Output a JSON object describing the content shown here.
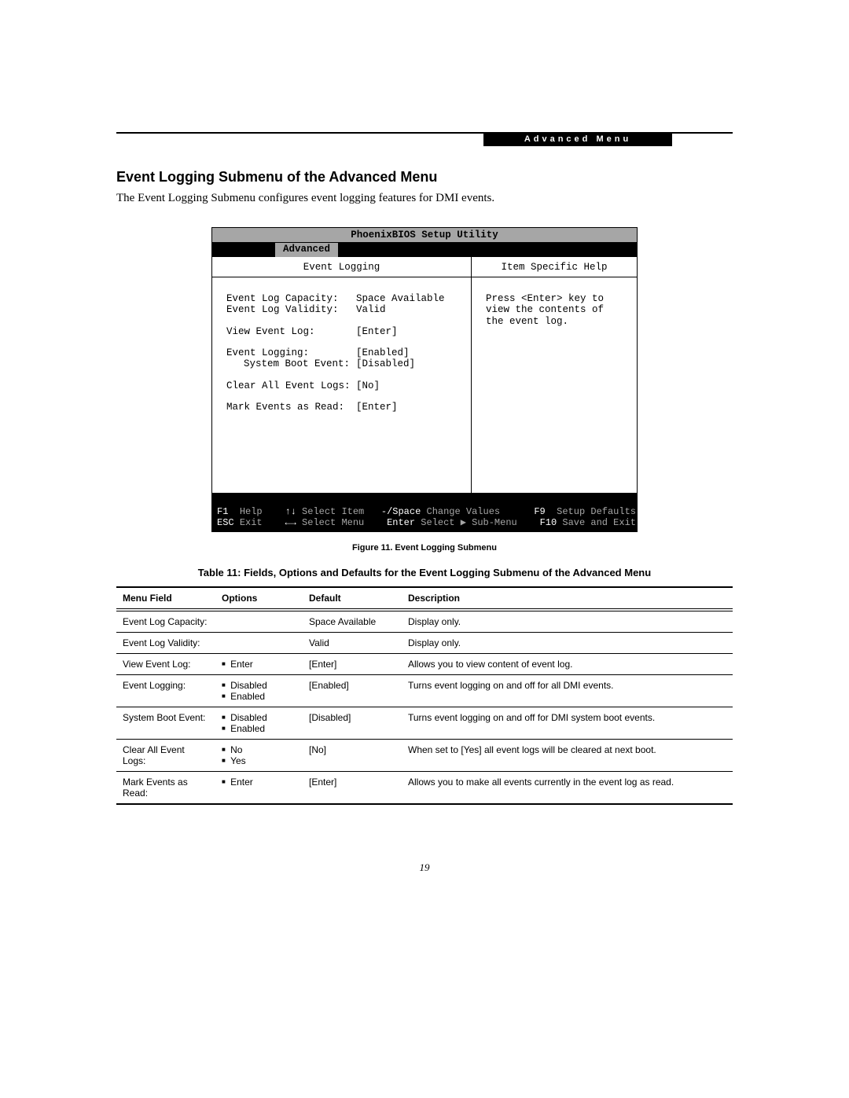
{
  "header_tag": "Advanced Menu",
  "section_title": "Event Logging Submenu of the Advanced Menu",
  "intro": "The Event Logging Submenu configures event logging features for DMI events.",
  "bios": {
    "title": "PhoenixBIOS Setup Utility",
    "tab": "Advanced",
    "left_title": "Event Logging",
    "right_title": "Item Specific Help",
    "help_text_1": "Press <Enter> key to",
    "help_text_2": "view the contents of",
    "help_text_3": "the event log.",
    "fields": {
      "capacity_label": "Event Log Capacity:",
      "capacity_value": "Space Available",
      "validity_label": "Event Log Validity:",
      "validity_value": "Valid",
      "view_label": "View Event Log:",
      "view_value": "[Enter]",
      "logging_label": "Event Logging:",
      "logging_value": "[Enabled]",
      "boot_label": "System Boot Event:",
      "boot_value": "[Disabled]",
      "clear_label": "Clear All Event Logs:",
      "clear_value": "[No]",
      "mark_label": "Mark Events as Read:",
      "mark_value": "[Enter]"
    },
    "footer": {
      "k_f1": "F1",
      "l_help": "Help",
      "k_arrows_v": "↑↓",
      "l_select_item": "Select Item",
      "k_space": "-/Space",
      "l_change": "Change Values",
      "k_f9": "F9",
      "l_defaults": "Setup Defaults",
      "k_esc": "ESC",
      "l_exit": "Exit",
      "k_arrows_h": "←→",
      "l_select_menu": "Select Menu",
      "k_enter": "Enter",
      "l_submenu": "Select ▶ Sub-Menu",
      "k_f10": "F10",
      "l_save": "Save and Exit"
    }
  },
  "fig_caption": "Figure 11.  Event Logging Submenu",
  "table_caption": "Table 11: Fields, Options and Defaults for the Event Logging Submenu of the Advanced Menu",
  "table": {
    "headers": {
      "c1": "Menu Field",
      "c2": "Options",
      "c3": "Default",
      "c4": "Description"
    },
    "rows": [
      {
        "field": "Event Log Capacity:",
        "opts": [],
        "default": "Space Available",
        "desc": "Display only."
      },
      {
        "field": "Event Log Validity:",
        "opts": [],
        "default": "Valid",
        "desc": "Display only."
      },
      {
        "field": "View Event Log:",
        "opts": [
          "Enter"
        ],
        "default": "[Enter]",
        "desc": "Allows you to view content of event log."
      },
      {
        "field": "Event Logging:",
        "opts": [
          "Disabled",
          "Enabled"
        ],
        "default": "[Enabled]",
        "desc": "Turns event logging on and off for all DMI events."
      },
      {
        "field": "System Boot Event:",
        "indent": true,
        "opts": [
          "Disabled",
          "Enabled"
        ],
        "default": "[Disabled]",
        "desc": "Turns event logging on and off for DMI system boot events."
      },
      {
        "field": "Clear All Event Logs:",
        "opts": [
          "No",
          "Yes"
        ],
        "default": "[No]",
        "desc": "When set to [Yes] all event logs will be cleared at next boot."
      },
      {
        "field": "Mark Events as Read:",
        "opts": [
          "Enter"
        ],
        "default": "[Enter]",
        "desc": "Allows you to make all events currently in the event log as read."
      }
    ]
  },
  "page_number": "19"
}
